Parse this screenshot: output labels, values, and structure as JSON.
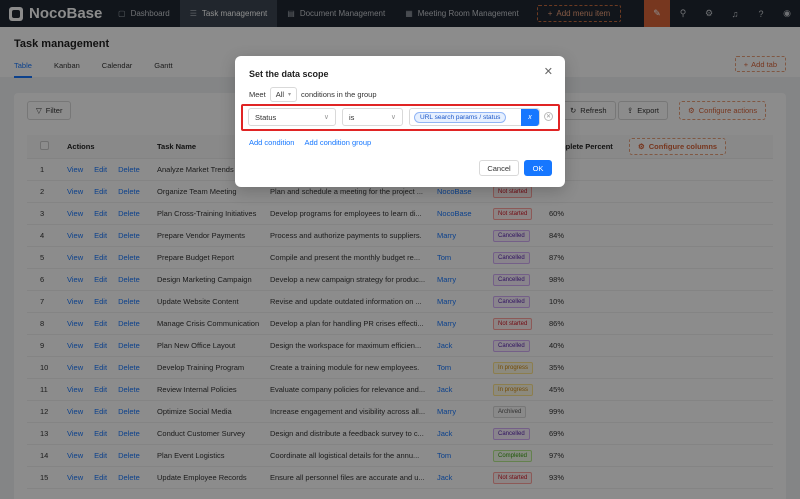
{
  "app": {
    "logo": "NocoBase",
    "menu": [
      {
        "label": "Dashboard",
        "icon": "dashboard-icon",
        "glyph": "▢"
      },
      {
        "label": "Task management",
        "icon": "list-icon",
        "glyph": "☰",
        "active": true
      },
      {
        "label": "Document Management",
        "icon": "file-icon",
        "glyph": "▤"
      },
      {
        "label": "Meeting Room Management",
        "icon": "calendar-icon",
        "glyph": "▦"
      }
    ],
    "add_menu_label": "Add menu item"
  },
  "page": {
    "title": "Task management",
    "tabs": [
      "Table",
      "Kanban",
      "Calendar",
      "Gantt"
    ],
    "add_tab_label": "Add tab"
  },
  "toolbar": {
    "filter_label": "Filter",
    "refresh_label": "Refresh",
    "export_label": "Export",
    "configure_actions_label": "Configure actions"
  },
  "table": {
    "headers": {
      "actions": "Actions",
      "task_name": "Task Name",
      "complete_percent": "Complete Percent",
      "configure_columns": "Configure columns"
    },
    "action_labels": [
      "View",
      "Edit",
      "Delete"
    ],
    "rows": [
      {
        "idx": "1",
        "name": "Analyze Market Trends",
        "desc": "",
        "user": "",
        "status": "",
        "pct": ""
      },
      {
        "idx": "2",
        "name": "Organize Team Meeting",
        "desc": "Plan and schedule a meeting for the project ...",
        "user": "NocoBase",
        "status": "Not started",
        "pct": ""
      },
      {
        "idx": "3",
        "name": "Plan Cross-Training Initiatives",
        "desc": "Develop programs for employees to learn di...",
        "user": "NocoBase",
        "status": "Not started",
        "pct": "60%"
      },
      {
        "idx": "4",
        "name": "Prepare Vendor Payments",
        "desc": "Process and authorize payments to suppliers.",
        "user": "Marry",
        "status": "Cancelled",
        "pct": "84%"
      },
      {
        "idx": "5",
        "name": "Prepare Budget Report",
        "desc": "Compile and present the monthly budget re...",
        "user": "Tom",
        "status": "Cancelled",
        "pct": "87%"
      },
      {
        "idx": "6",
        "name": "Design Marketing Campaign",
        "desc": "Develop a new campaign strategy for produc...",
        "user": "Marry",
        "status": "Cancelled",
        "pct": "98%"
      },
      {
        "idx": "7",
        "name": "Update Website Content",
        "desc": "Revise and update outdated information on ...",
        "user": "Marry",
        "status": "Cancelled",
        "pct": "10%"
      },
      {
        "idx": "8",
        "name": "Manage Crisis Communication",
        "desc": "Develop a plan for handling PR crises effecti...",
        "user": "Marry",
        "status": "Not started",
        "pct": "86%"
      },
      {
        "idx": "9",
        "name": "Plan New Office Layout",
        "desc": "Design the workspace for maximum efficien...",
        "user": "Jack",
        "status": "Cancelled",
        "pct": "40%"
      },
      {
        "idx": "10",
        "name": "Develop Training Program",
        "desc": "Create a training module for new employees.",
        "user": "Tom",
        "status": "In progress",
        "pct": "35%"
      },
      {
        "idx": "11",
        "name": "Review Internal Policies",
        "desc": "Evaluate company policies for relevance and...",
        "user": "Jack",
        "status": "In progress",
        "pct": "45%"
      },
      {
        "idx": "12",
        "name": "Optimize Social Media",
        "desc": "Increase engagement and visibility across all...",
        "user": "Marry",
        "status": "Archived",
        "pct": "99%"
      },
      {
        "idx": "13",
        "name": "Conduct Customer Survey",
        "desc": "Design and distribute a feedback survey to c...",
        "user": "Jack",
        "status": "Cancelled",
        "pct": "69%"
      },
      {
        "idx": "14",
        "name": "Plan Event Logistics",
        "desc": "Coordinate all logistical details for the annu...",
        "user": "Tom",
        "status": "Completed",
        "pct": "97%"
      },
      {
        "idx": "15",
        "name": "Update Employee Records",
        "desc": "Ensure all personnel files are accurate and u...",
        "user": "Jack",
        "status": "Not started",
        "pct": "93%"
      }
    ]
  },
  "status_colors": {
    "Not started": {
      "color": "#cf1322",
      "bg": "#fff1f0",
      "border": "#ffa39e"
    },
    "Cancelled": {
      "color": "#531dab",
      "bg": "#f9f0ff",
      "border": "#d3adf7"
    },
    "In progress": {
      "color": "#d48806",
      "bg": "#fffbe6",
      "border": "#ffe58f"
    },
    "Archived": {
      "color": "#555555",
      "bg": "#fafafa",
      "border": "#d9d9d9"
    },
    "Completed": {
      "color": "#389e0d",
      "bg": "#f6ffed",
      "border": "#b7eb8f"
    }
  },
  "modal": {
    "title": "Set the data scope",
    "meet_label": "Meet",
    "meet_value": "All",
    "meet_suffix": "conditions in the group",
    "condition": {
      "field": "Status",
      "operator": "is",
      "value_tag": "URL search params / status",
      "variable_button": "x"
    },
    "add_condition_label": "Add condition",
    "add_group_label": "Add condition group",
    "cancel_label": "Cancel",
    "ok_label": "OK"
  },
  "colors": {
    "primary": "#1677ff",
    "accent": "#d9643a",
    "topbar": "#1f2732",
    "highlight": "#e02424"
  }
}
